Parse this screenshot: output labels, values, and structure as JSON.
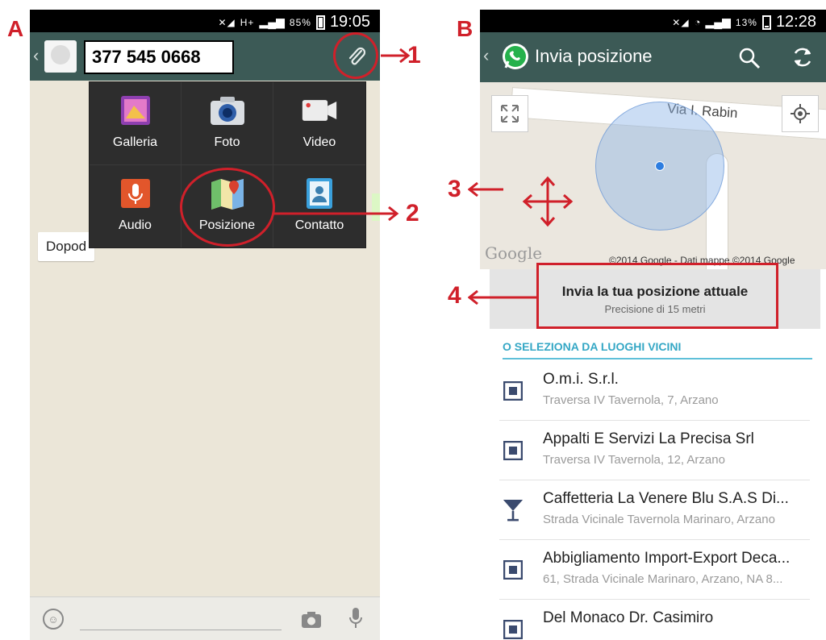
{
  "colors": {
    "whatsapp_actionbar": "#3c5a56",
    "callout_red": "#d0202a",
    "accent_blue": "#34a7c5"
  },
  "labels": {
    "phone_a": "A",
    "phone_b": "B",
    "n1": "1",
    "n2": "2",
    "n3": "3",
    "n4": "4"
  },
  "phone_a": {
    "status": {
      "network": "H+",
      "battery": "85%",
      "time": "19:05"
    },
    "contact_name": "377 545 0668",
    "chat_snippet": "Dopod",
    "attach_menu": [
      {
        "label": "Galleria",
        "icon": "gallery-icon"
      },
      {
        "label": "Foto",
        "icon": "camera-icon"
      },
      {
        "label": "Video",
        "icon": "video-icon"
      },
      {
        "label": "Audio",
        "icon": "microphone-icon"
      },
      {
        "label": "Posizione",
        "icon": "map-pin-icon"
      },
      {
        "label": "Contatto",
        "icon": "contact-card-icon"
      }
    ]
  },
  "phone_b": {
    "status": {
      "battery": "13%",
      "time": "12:28"
    },
    "title": "Invia posizione",
    "map": {
      "street": "Via I. Rabin",
      "google_logo": "Google",
      "attribution": "©2014 Google - Dati mappe ©2014 Google"
    },
    "send_current": {
      "title": "Invia la tua posizione attuale",
      "precision": "Precisione di 15 metri"
    },
    "nearby_header": "O SELEZIONA DA LUOGHI VICINI",
    "places": [
      {
        "name": "O.m.i. S.r.l.",
        "address": "Traversa IV Tavernola, 7, Arzano",
        "icon": "building-icon"
      },
      {
        "name": "Appalti E Servizi La Precisa Srl",
        "address": "Traversa IV Tavernola, 12, Arzano",
        "icon": "building-icon"
      },
      {
        "name": "Caffetteria La Venere Blu S.A.S Di...",
        "address": "Strada Vicinale Tavernola Marinaro, Arzano",
        "icon": "cocktail-icon"
      },
      {
        "name": "Abbigliamento Import-Export Deca...",
        "address": "61, Strada Vicinale Marinaro, Arzano, NA 8...",
        "icon": "building-icon"
      },
      {
        "name": "Del Monaco Dr. Casimiro",
        "address": "",
        "icon": "building-icon"
      }
    ]
  }
}
